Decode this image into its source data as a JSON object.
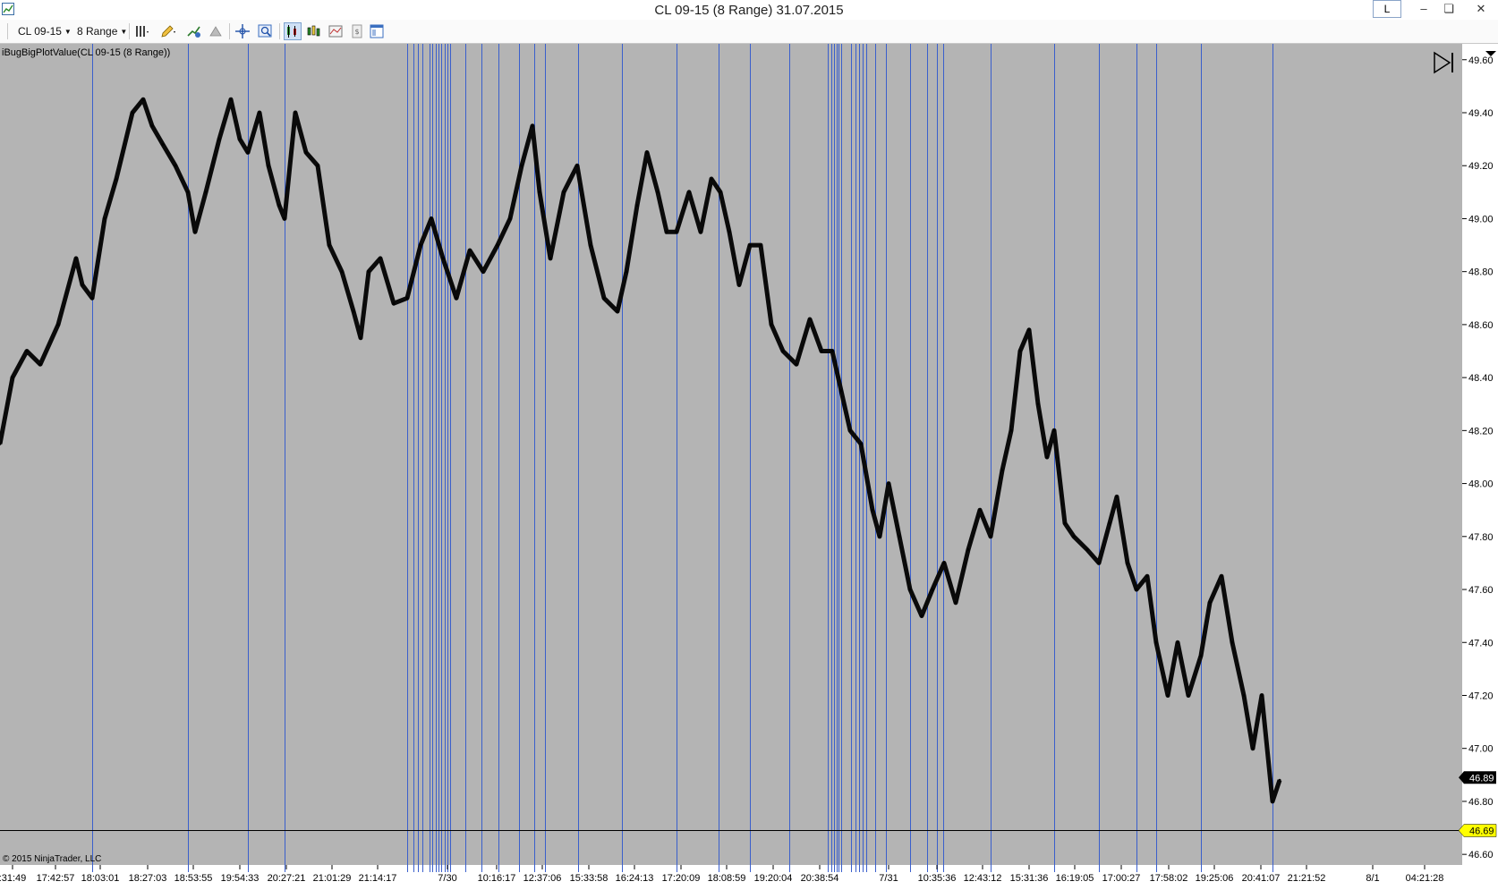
{
  "window": {
    "title": "CL 09-15 (8 Range)  31.07.2015",
    "l_button": "L",
    "minimize_glyph": "–",
    "restore_glyph": "❏",
    "close_glyph": "✕"
  },
  "toolbar": {
    "instrument": "CL 09-15",
    "period": "8 Range",
    "icons": [
      "bar-style-icon",
      "draw-pencil-icon",
      "indicator-plus-icon",
      "strategy-icon",
      "crosshair-icon",
      "zoom-icon",
      "data-box-icon",
      "chart-trader-icon",
      "properties-icon",
      "print-icon",
      "layout-icon"
    ]
  },
  "chart": {
    "indicator_label": "iBugBigPlotValue(CL 09-15 (8 Range))",
    "copyright": "© 2015 NinjaTrader, LLC",
    "background": "#b4b4b4",
    "vline_color": "#3a5fcc",
    "price_line_color": "#000000",
    "last_price": "46.89",
    "marker_price": "46.69",
    "colors": {
      "badge_yellow": "#ffff00",
      "badge_black": "#000000"
    }
  },
  "chart_data": {
    "type": "line",
    "title": "",
    "xlabel": "",
    "ylabel": "",
    "ylim": [
      46.56,
      49.66
    ],
    "y_ticks": [
      "49.60",
      "49.40",
      "49.20",
      "49.00",
      "48.80",
      "48.60",
      "48.40",
      "48.20",
      "48.00",
      "47.80",
      "47.60",
      "47.40",
      "47.20",
      "47.00",
      "46.80",
      "46.60"
    ],
    "x_ticks": [
      ":31:49",
      "17:42:57",
      "18:03:01",
      "18:27:03",
      "18:53:55",
      "19:54:33",
      "20:27:21",
      "21:01:29",
      "21:14:17",
      "7/30",
      "10:16:17",
      "12:37:06",
      "15:33:58",
      "16:24:13",
      "17:20:09",
      "18:08:59",
      "19:20:04",
      "20:38:54",
      "7/31",
      "10:35:36",
      "12:43:12",
      "15:31:36",
      "16:19:05",
      "17:00:27",
      "17:58:02",
      "19:25:06",
      "20:41:07",
      "21:21:52",
      "8/1",
      "04:21:28"
    ],
    "horizontal_line": 46.69,
    "vertical_lines_bar_index": [
      103,
      210,
      277,
      318,
      455,
      462,
      467,
      472,
      480,
      483,
      487,
      490,
      493,
      497,
      500,
      503,
      520,
      538,
      557,
      580,
      597,
      609,
      646,
      695,
      756,
      803,
      838,
      882,
      925,
      929,
      932,
      935,
      937,
      940,
      951,
      956,
      960,
      964,
      968,
      978,
      990,
      1017,
      1036,
      1047,
      1054,
      1107,
      1178,
      1228,
      1270,
      1292,
      1342,
      1422
    ],
    "series": [
      {
        "name": "",
        "bar_index": [
          0,
          14,
          30,
          45,
          65,
          85,
          92,
          103,
          117,
          130,
          148,
          160,
          170,
          182,
          196,
          210,
          218,
          230,
          245,
          258,
          268,
          277,
          290,
          300,
          312,
          318,
          330,
          342,
          355,
          368,
          382,
          395,
          403,
          412,
          425,
          440,
          455,
          470,
          482,
          495,
          510,
          525,
          540,
          556,
          570,
          583,
          595,
          603,
          615,
          630,
          645,
          660,
          675,
          690,
          700,
          712,
          723,
          735,
          745,
          756,
          770,
          783,
          795,
          805,
          815,
          826,
          838,
          850,
          862,
          875,
          890,
          905,
          918,
          930,
          940,
          950,
          962,
          975,
          983,
          993,
          1005,
          1017,
          1030,
          1042,
          1055,
          1068,
          1082,
          1095,
          1107,
          1120,
          1130,
          1140,
          1150,
          1160,
          1170,
          1178,
          1190,
          1200,
          1215,
          1228,
          1240,
          1248,
          1260,
          1270,
          1282,
          1292,
          1305,
          1316,
          1328,
          1342,
          1352,
          1365,
          1377,
          1390,
          1400,
          1410,
          1422,
          1430
        ],
        "values": [
          48.15,
          48.4,
          48.5,
          48.45,
          48.6,
          48.85,
          48.75,
          48.7,
          49.0,
          49.15,
          49.4,
          49.45,
          49.35,
          49.28,
          49.2,
          49.1,
          48.95,
          49.1,
          49.3,
          49.45,
          49.3,
          49.25,
          49.4,
          49.2,
          49.05,
          49.0,
          49.4,
          49.25,
          49.2,
          48.9,
          48.8,
          48.65,
          48.55,
          48.8,
          48.85,
          48.68,
          48.7,
          48.9,
          49.0,
          48.85,
          48.7,
          48.88,
          48.8,
          48.9,
          49.0,
          49.2,
          49.35,
          49.1,
          48.85,
          49.1,
          49.2,
          48.9,
          48.7,
          48.65,
          48.8,
          49.05,
          49.25,
          49.1,
          48.95,
          48.95,
          49.1,
          48.95,
          49.15,
          49.1,
          48.95,
          48.75,
          48.9,
          48.9,
          48.6,
          48.5,
          48.45,
          48.62,
          48.5,
          48.5,
          48.35,
          48.2,
          48.15,
          47.9,
          47.8,
          48.0,
          47.8,
          47.6,
          47.5,
          47.6,
          47.7,
          47.55,
          47.75,
          47.9,
          47.8,
          48.05,
          48.2,
          48.5,
          48.58,
          48.3,
          48.1,
          48.2,
          47.85,
          47.8,
          47.75,
          47.7,
          47.85,
          47.95,
          47.7,
          47.6,
          47.65,
          47.4,
          47.2,
          47.4,
          47.2,
          47.35,
          47.55,
          47.65,
          47.4,
          47.2,
          47.0,
          47.2,
          46.8,
          46.88
        ]
      }
    ]
  }
}
